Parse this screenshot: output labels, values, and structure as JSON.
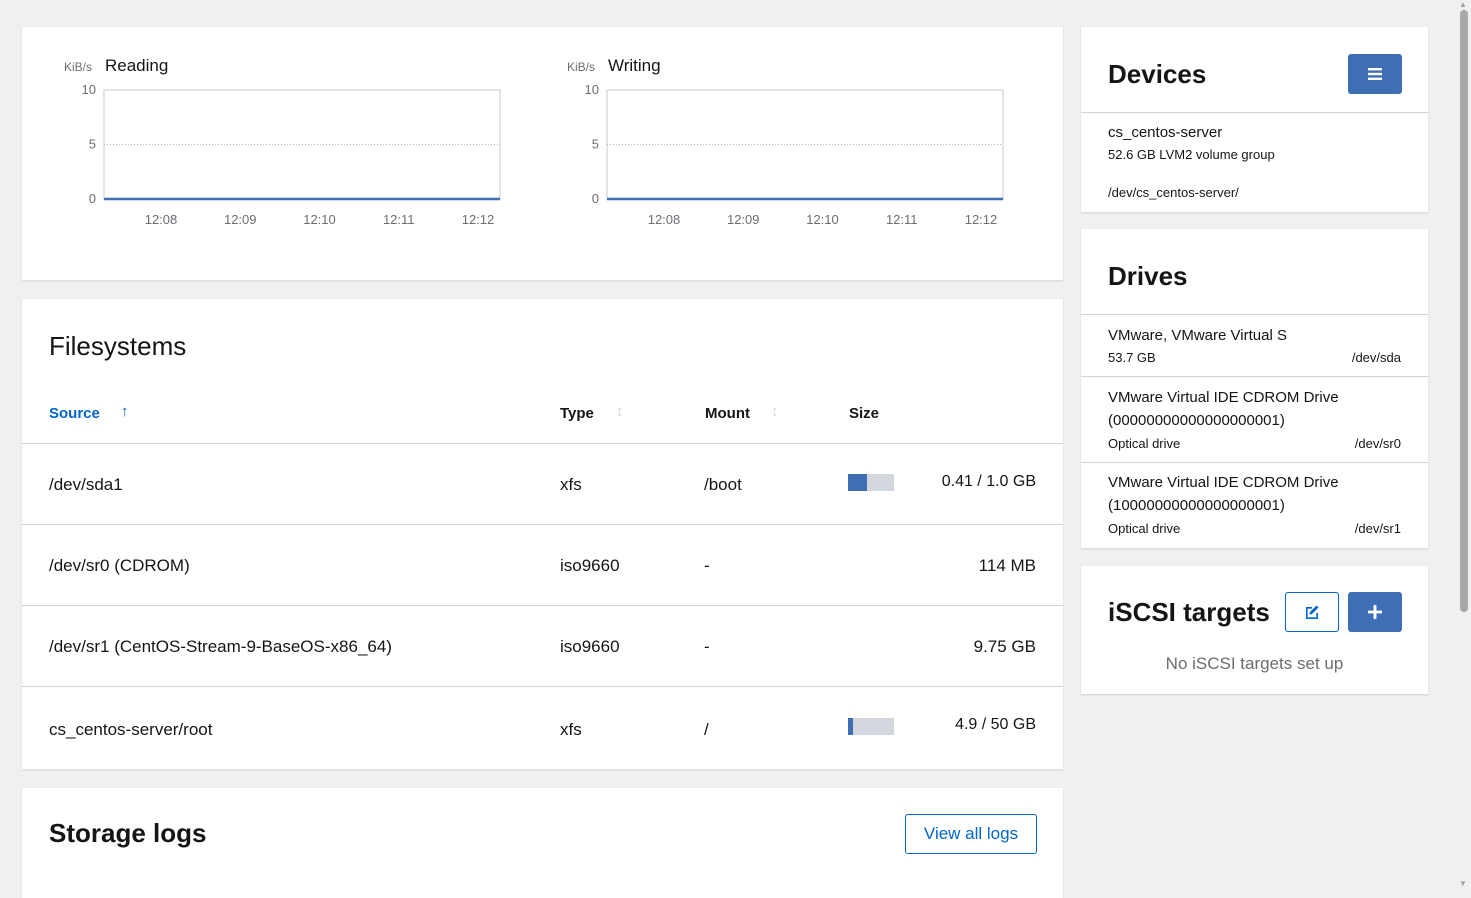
{
  "charts": {
    "reading": {
      "unit": "KiB/s",
      "title": "Reading",
      "y_ticks": [
        "10",
        "5",
        "0"
      ],
      "x_ticks": [
        "12:08",
        "12:09",
        "12:10",
        "12:11",
        "12:12"
      ]
    },
    "writing": {
      "unit": "KiB/s",
      "title": "Writing",
      "y_ticks": [
        "10",
        "5",
        "0"
      ],
      "x_ticks": [
        "12:08",
        "12:09",
        "12:10",
        "12:11",
        "12:12"
      ]
    }
  },
  "chart_data": [
    {
      "type": "line",
      "title": "Reading",
      "ylabel": "KiB/s",
      "x": [
        "12:08",
        "12:09",
        "12:10",
        "12:11",
        "12:12"
      ],
      "ylim": [
        0,
        10
      ],
      "series": [
        {
          "values": [
            0,
            0,
            0,
            0,
            0
          ]
        }
      ],
      "grid": true,
      "color": "#3e6fb5"
    },
    {
      "type": "line",
      "title": "Writing",
      "ylabel": "KiB/s",
      "x": [
        "12:08",
        "12:09",
        "12:10",
        "12:11",
        "12:12"
      ],
      "ylim": [
        0,
        10
      ],
      "series": [
        {
          "values": [
            0,
            0,
            0,
            0,
            0
          ]
        }
      ],
      "grid": true,
      "color": "#3e6fb5"
    }
  ],
  "filesystems": {
    "title": "Filesystems",
    "columns": {
      "source": "Source",
      "type": "Type",
      "mount": "Mount",
      "size": "Size"
    },
    "sort_icon": "↑",
    "sort_neutral_icon": "↕",
    "rows": [
      {
        "source": "/dev/sda1",
        "type": "xfs",
        "mount": "/boot",
        "size": "0.41 / 1.0 GB",
        "usage": 0.41
      },
      {
        "source": "/dev/sr0 (CDROM)",
        "type": "iso9660",
        "mount": "-",
        "size": "114 MB"
      },
      {
        "source": "/dev/sr1 (CentOS-Stream-9-BaseOS-x86_64)",
        "type": "iso9660",
        "mount": "-",
        "size": "9.75 GB"
      },
      {
        "source": "cs_centos-server/root",
        "type": "xfs",
        "mount": "/",
        "size": "4.9 / 50 GB",
        "usage": 0.098
      }
    ]
  },
  "storage_logs": {
    "title": "Storage logs",
    "view_all": "View all logs"
  },
  "devices": {
    "title": "Devices",
    "menu_icon": "hamburger-menu-icon",
    "items": [
      {
        "name": "cs_centos-server",
        "desc": "52.6 GB LVM2 volume group",
        "path": "/dev/cs_centos-server/"
      }
    ]
  },
  "drives": {
    "title": "Drives",
    "items": [
      {
        "name": "VMware, VMware Virtual S",
        "sub": "53.7 GB",
        "path": "/dev/sda"
      },
      {
        "name": "VMware Virtual IDE CDROM Drive",
        "name2": "(00000000000000000001)",
        "sub": "Optical drive",
        "path": "/dev/sr0"
      },
      {
        "name": "VMware Virtual IDE CDROM Drive",
        "name2": "(10000000000000000001)",
        "sub": "Optical drive",
        "path": "/dev/sr1"
      }
    ]
  },
  "iscsi": {
    "title": "iSCSI targets",
    "empty": "No iSCSI targets set up",
    "edit_icon": "edit-icon",
    "add_icon": "plus-icon"
  },
  "colors": {
    "accent": "#3e6fb5",
    "link": "#0066cc",
    "border": "#d2d2d2"
  }
}
